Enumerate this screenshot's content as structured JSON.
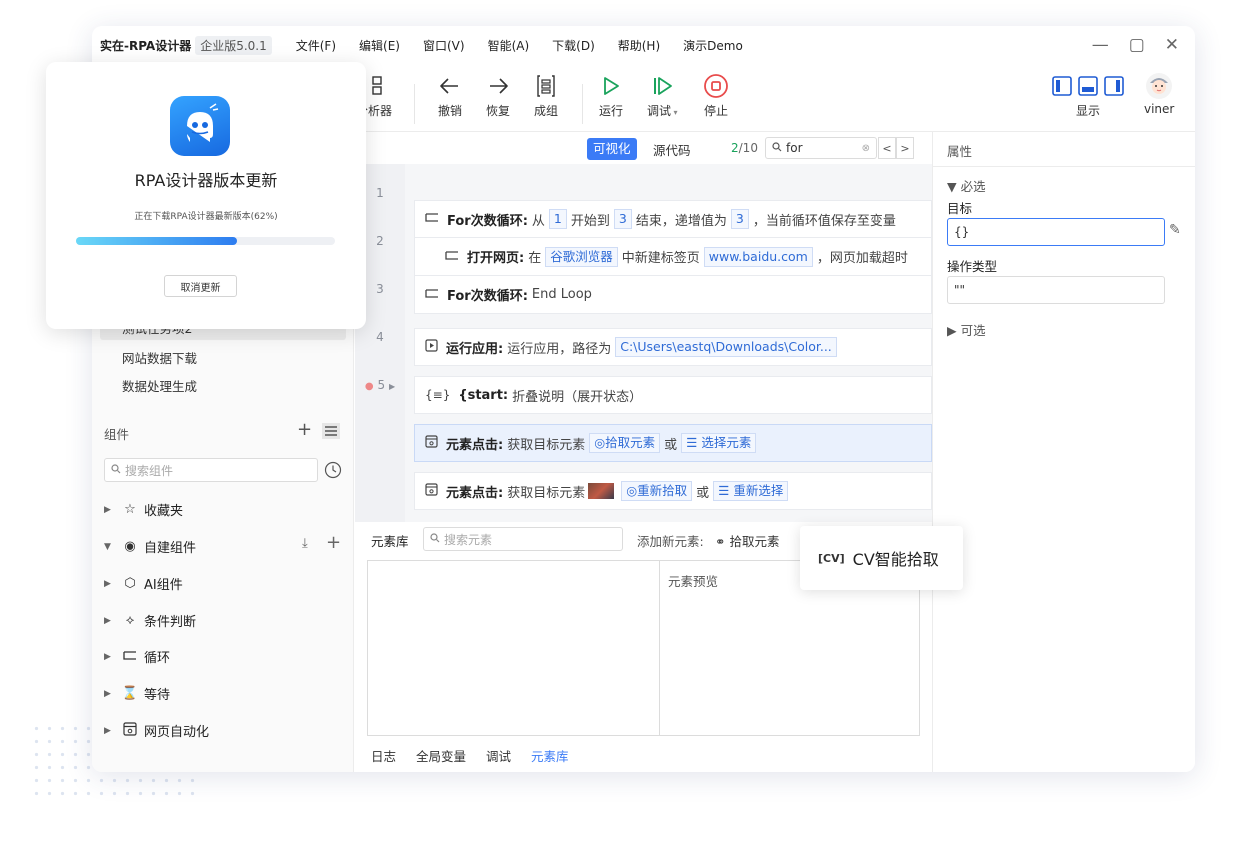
{
  "window": {
    "app_name": "实在-RPA设计器",
    "version": "企业版5.0.1",
    "menu": [
      "文件(F)",
      "编辑(E)",
      "窗口(V)",
      "智能(A)",
      "下载(D)",
      "帮助(H)",
      "演示Demo"
    ],
    "controls": {
      "minimize": "—",
      "maximize": "▢",
      "close": "✕"
    }
  },
  "toolbar": {
    "analyzer": "分析器",
    "undo": "撤销",
    "redo": "恢复",
    "group": "成组",
    "run": "运行",
    "debug": "调试",
    "stop": "停止",
    "display": "显示",
    "user": "viner",
    "colors": {
      "run": "#1aa35c",
      "stop": "#e84b4b"
    }
  },
  "left_panel": {
    "tasks": [
      "测试任务项2",
      "网站数据下载",
      "数据处理生成"
    ],
    "components_title": "组件",
    "search_placeholder": "搜索组件",
    "tree": [
      {
        "label": "收藏夹",
        "icon": "star-icon",
        "expanded": false
      },
      {
        "label": "自建组件",
        "icon": "hexagon-icon",
        "expanded": true
      },
      {
        "label": "AI组件",
        "icon": "cube-icon",
        "expanded": false
      },
      {
        "label": "条件判断",
        "icon": "branch-icon",
        "expanded": false
      },
      {
        "label": "循环",
        "icon": "loop-icon",
        "expanded": false
      },
      {
        "label": "等待",
        "icon": "hourglass-icon",
        "expanded": false
      },
      {
        "label": "网页自动化",
        "icon": "webpage-icon",
        "expanded": false
      }
    ]
  },
  "editor": {
    "visual_tab": "可视化",
    "source_tab": "源代码",
    "match_current": "2",
    "match_total": "/10",
    "find_value": "for",
    "lines": [
      "1",
      "2",
      "3",
      "4",
      "5"
    ],
    "steps": {
      "s1": {
        "kw": "For次数循环:",
        "t1": "从",
        "v1": "1",
        "t2": "开始到",
        "v2": "3",
        "t3": "结束，递增值为",
        "v3": "3",
        "t4": "，当前循环值保存至变量"
      },
      "s2": {
        "kw": "打开网页:",
        "t1": "在",
        "v1": "谷歌浏览器",
        "t2": "中新建标签页",
        "v2": "www.baidu.com",
        "t3": "，网页加载超时"
      },
      "s3": {
        "kw": "For次数循环:",
        "t1": "End Loop"
      },
      "s4": {
        "kw": "运行应用:",
        "t1": "运行应用，路径为",
        "v1": "C:\\Users\\eastq\\Downloads\\Color..."
      },
      "s5": {
        "kw": "{start:",
        "t1": "折叠说明（展开状态）"
      },
      "s6": {
        "kw": "元素点击:",
        "t1": "获取目标元素",
        "v1": "拾取元素",
        "t2": "或",
        "v2": "选择元素"
      },
      "s7": {
        "kw": "元素点击:",
        "t1": "获取目标元素",
        "v1": "重新拾取",
        "t2": "或",
        "v2": "重新选择"
      }
    }
  },
  "bottom": {
    "title": "元素库",
    "search_placeholder": "搜索元素",
    "add_label": "添加新元素:",
    "pick_label": "拾取元素",
    "preview_label": "元素预览",
    "tabs": [
      "日志",
      "全局变量",
      "调试",
      "元素库"
    ],
    "active_tab": "元素库"
  },
  "properties": {
    "title": "属性",
    "required": "▼ 必选",
    "target_label": "目标",
    "target_value": "{}",
    "op_label": "操作类型",
    "op_value": "\"\"",
    "optional": "▶ 可选"
  },
  "cv_popup": {
    "label": "CV智能拾取"
  },
  "update": {
    "title": "RPA设计器版本更新",
    "status": "正在下载RPA设计器最新版本(62%)",
    "progress": 0.62,
    "cancel": "取消更新"
  }
}
